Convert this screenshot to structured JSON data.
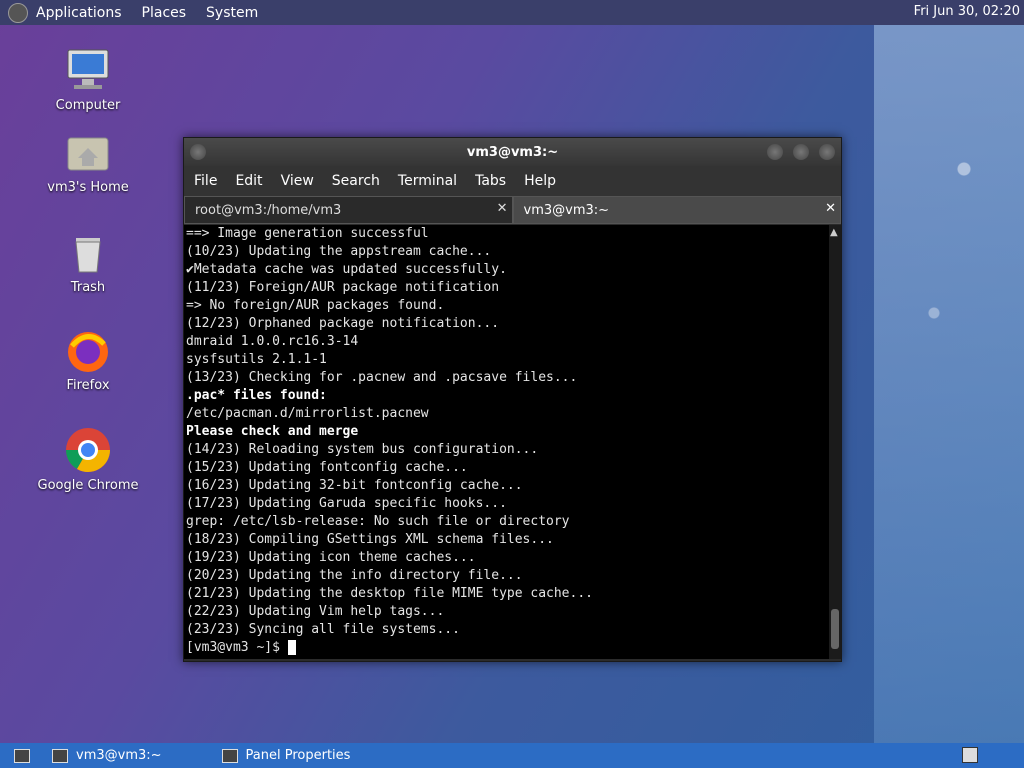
{
  "top_panel": {
    "menus": [
      "Applications",
      "Places",
      "System"
    ],
    "clock": "Fri Jun 30, 02:20"
  },
  "desktop": {
    "icons": [
      {
        "label": "Computer"
      },
      {
        "label": "vm3's Home"
      },
      {
        "label": "Trash"
      },
      {
        "label": "Firefox"
      },
      {
        "label": "Google Chrome"
      }
    ]
  },
  "terminal": {
    "title": "vm3@vm3:~",
    "menu": [
      "File",
      "Edit",
      "View",
      "Search",
      "Terminal",
      "Tabs",
      "Help"
    ],
    "tabs": [
      "root@vm3:/home/vm3",
      "vm3@vm3:~"
    ],
    "lines": [
      {
        "text": "==> Image generation successful",
        "bold": false
      },
      {
        "text": "(10/23) Updating the appstream cache...",
        "bold": false
      },
      {
        "text": "✔Metadata cache was updated successfully.",
        "bold": false
      },
      {
        "text": "(11/23) Foreign/AUR package notification",
        "bold": false
      },
      {
        "text": "=> No foreign/AUR packages found.",
        "bold": false
      },
      {
        "text": "(12/23) Orphaned package notification...",
        "bold": false
      },
      {
        "text": "dmraid 1.0.0.rc16.3-14",
        "bold": false
      },
      {
        "text": "sysfsutils 2.1.1-1",
        "bold": false
      },
      {
        "text": "(13/23) Checking for .pacnew and .pacsave files...",
        "bold": false
      },
      {
        "text": ".pac* files found:",
        "bold": true
      },
      {
        "text": "/etc/pacman.d/mirrorlist.pacnew",
        "bold": false
      },
      {
        "text": "Please check and merge",
        "bold": true
      },
      {
        "text": "(14/23) Reloading system bus configuration...",
        "bold": false
      },
      {
        "text": "(15/23) Updating fontconfig cache...",
        "bold": false
      },
      {
        "text": "(16/23) Updating 32-bit fontconfig cache...",
        "bold": false
      },
      {
        "text": "(17/23) Updating Garuda specific hooks...",
        "bold": false
      },
      {
        "text": "grep: /etc/lsb-release: No such file or directory",
        "bold": false
      },
      {
        "text": "(18/23) Compiling GSettings XML schema files...",
        "bold": false
      },
      {
        "text": "(19/23) Updating icon theme caches...",
        "bold": false
      },
      {
        "text": "(20/23) Updating the info directory file...",
        "bold": false
      },
      {
        "text": "(21/23) Updating the desktop file MIME type cache...",
        "bold": false
      },
      {
        "text": "(22/23) Updating Vim help tags...",
        "bold": false
      },
      {
        "text": "(23/23) Syncing all file systems...",
        "bold": false
      }
    ],
    "prompt": "[vm3@vm3 ~]$ "
  },
  "bottom_panel": {
    "items": [
      "vm3@vm3:~",
      "Panel Properties"
    ]
  }
}
